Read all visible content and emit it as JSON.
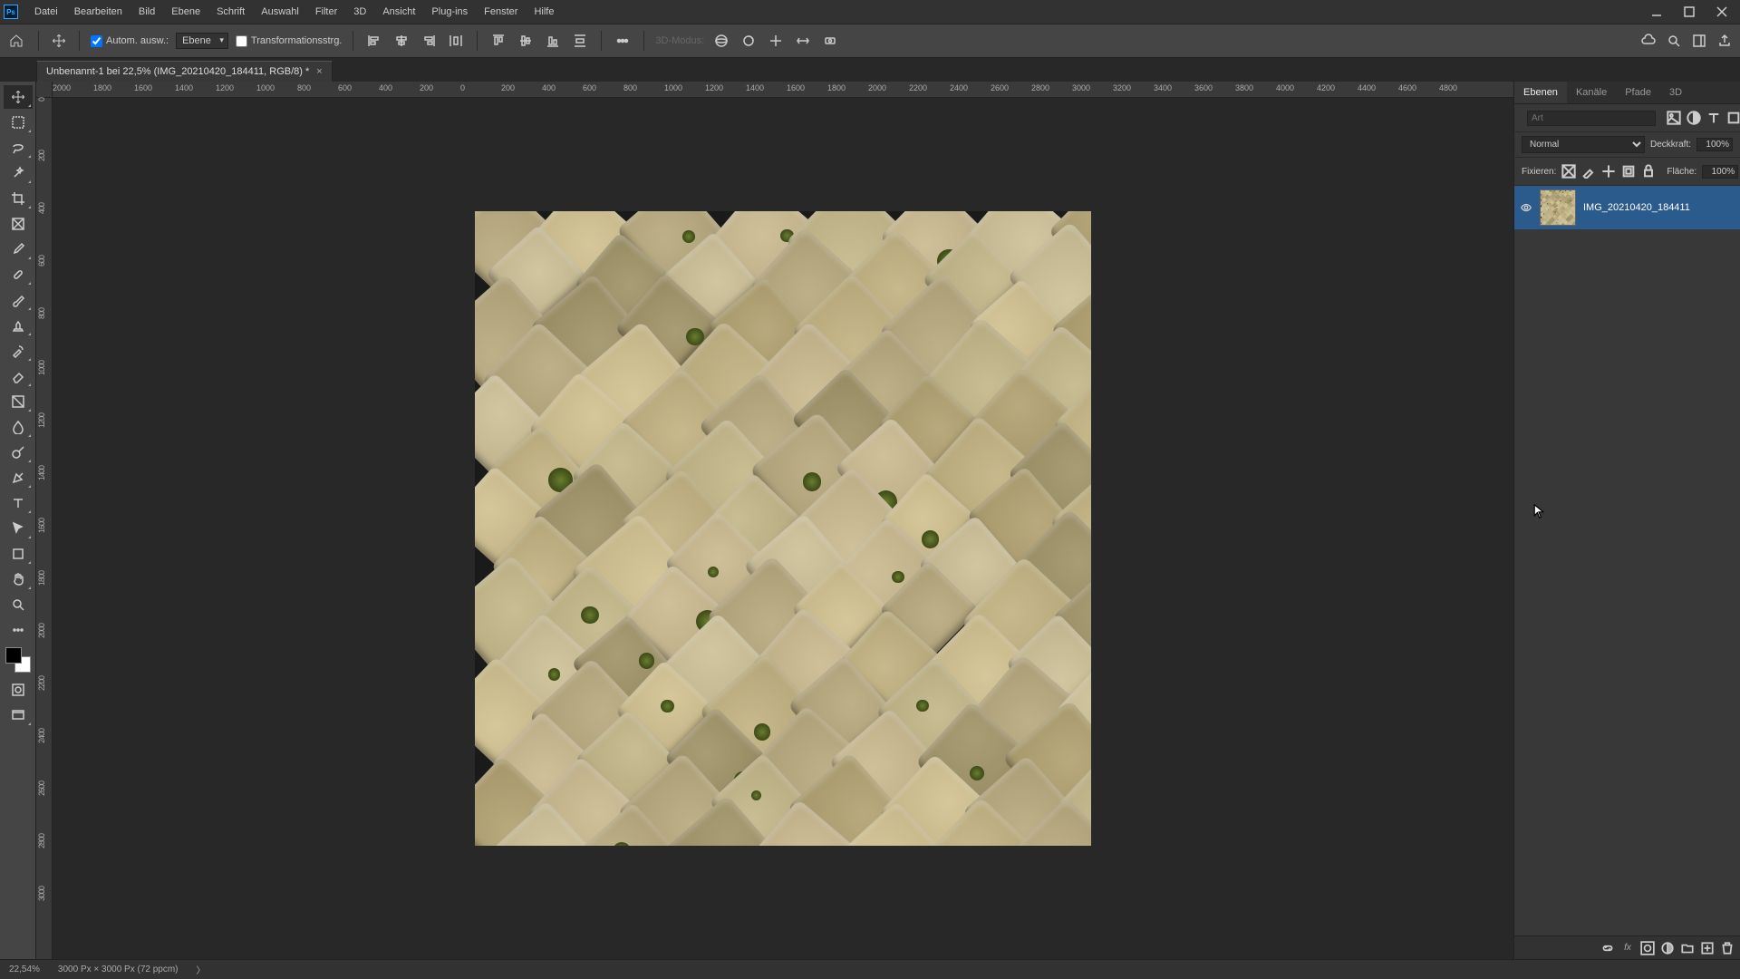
{
  "menu": [
    "Datei",
    "Bearbeiten",
    "Bild",
    "Ebene",
    "Schrift",
    "Auswahl",
    "Filter",
    "3D",
    "Ansicht",
    "Plug-ins",
    "Fenster",
    "Hilfe"
  ],
  "options": {
    "autoSelect": "Autom. ausw.:",
    "layerSelect": "Ebene",
    "transform": "Transformationsstrg.",
    "mode3d": "3D-Modus:"
  },
  "docTab": "Unbenannt-1 bei 22,5% (IMG_20210420_184411, RGB/8) *",
  "rulerH": [
    "2000",
    "1800",
    "1600",
    "1400",
    "1200",
    "1000",
    "800",
    "600",
    "400",
    "200",
    "0",
    "200",
    "400",
    "600",
    "800",
    "1000",
    "1200",
    "1400",
    "1600",
    "1800",
    "2000",
    "2200",
    "2400",
    "2600",
    "2800",
    "3000",
    "3200",
    "3400",
    "3600",
    "3800",
    "4000",
    "4200",
    "4400",
    "4600",
    "4800"
  ],
  "rulerV": [
    "0",
    "200",
    "400",
    "600",
    "800",
    "1000",
    "1200",
    "1400",
    "1600",
    "1800",
    "2000",
    "2200",
    "2400",
    "2600",
    "2800",
    "3000"
  ],
  "panelTabs": [
    "Ebenen",
    "Kanäle",
    "Pfade",
    "3D"
  ],
  "search": {
    "placeholder": "Art"
  },
  "blend": {
    "mode": "Normal",
    "opacityLabel": "Deckkraft:",
    "opacity": "100%",
    "lockLabel": "Fixieren:",
    "fillLabel": "Fläche:",
    "fill": "100%"
  },
  "layer": {
    "name": "IMG_20210420_184411"
  },
  "status": {
    "zoom": "22,54%",
    "dims": "3000 Px × 3000 Px (72 ppcm)"
  }
}
